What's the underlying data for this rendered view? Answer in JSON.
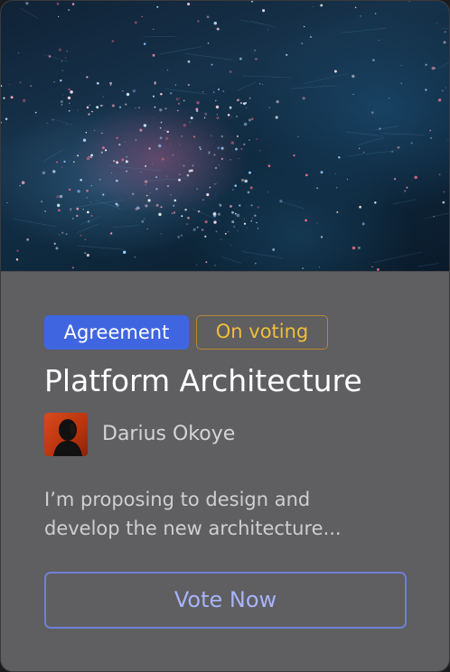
{
  "card": {
    "tags": {
      "category": "Agreement",
      "status": "On voting"
    },
    "title": "Platform Architecture",
    "author": {
      "name": "Darius Okoye"
    },
    "description": {
      "line1": "I’m proposing to design and",
      "line2": "develop the new architecture..."
    },
    "action": {
      "label": "Vote Now"
    }
  },
  "colors": {
    "card_bg": "#5f5e61",
    "tag_category_bg": "#3f66e0",
    "tag_status_text": "#f1bf35",
    "button_border": "#6f80d8",
    "button_text": "#a7b4f7"
  }
}
